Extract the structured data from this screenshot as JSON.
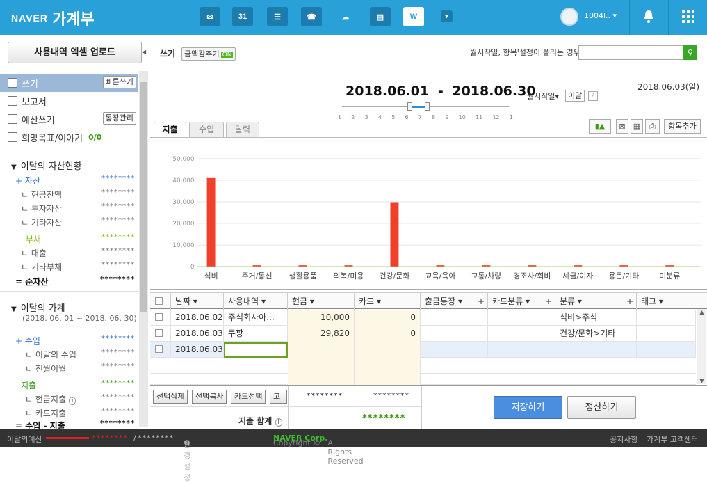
{
  "app": {
    "brand": "NAVER",
    "title": "가계부"
  },
  "topbar": {
    "icons": [
      "mail-icon",
      "calendar-icon",
      "list-icon",
      "contacts-icon",
      "cloud-icon",
      "memo-icon",
      "household-icon",
      "more-icon"
    ],
    "calendar_number": "31",
    "household_letter": "W",
    "username": "1004l..",
    "dropdown": "▾"
  },
  "sidebar": {
    "upload_button": "사용내역 엑셀 업로드",
    "menu": [
      {
        "label": "쓰기",
        "button": "빠른쓰기"
      },
      {
        "label": "보고서"
      },
      {
        "label": "예산쓰기",
        "button": "통장관리"
      },
      {
        "label": "희망목표/이야기",
        "extra": "0/0"
      }
    ],
    "assets_title": "이달의 자산현황",
    "assets": [
      {
        "label": "+ 자산",
        "value": "********"
      },
      {
        "label": "현금잔액",
        "value": "********"
      },
      {
        "label": "투자자산",
        "value": "********"
      },
      {
        "label": "기타자산",
        "value": "********"
      },
      {
        "label": "부채",
        "value": "********"
      },
      {
        "label": "대출",
        "value": "********"
      },
      {
        "label": "기타부채",
        "value": "********"
      },
      {
        "label": "= 순자산",
        "value": "********"
      }
    ],
    "ledger_title": "이달의 가계",
    "ledger_range": "(2018. 06. 01 ~ 2018. 06. 30)",
    "ledger": [
      {
        "label": "+ 수입",
        "value": "********"
      },
      {
        "label": "이달의 수입",
        "value": "********"
      },
      {
        "label": "전월이월",
        "value": "********"
      },
      {
        "label": "- 지출",
        "value": "********"
      },
      {
        "label": "현금지출",
        "value": "********"
      },
      {
        "label": "카드지출",
        "value": "********"
      },
      {
        "label": "= 수입 - 지출",
        "value": "********"
      }
    ]
  },
  "header": {
    "write_label": "쓰기",
    "hide_amount": "금액감추기",
    "on": "ON",
    "notice": "'월시작일, 항목'설정이 풀리는 경우",
    "search_placeholder": "",
    "date_start": "2018.06.01",
    "date_sep": "-",
    "date_end": "2018.06.30",
    "today": "2018.06.03(일)",
    "month_start": "월시작일▾",
    "this_month": "이달",
    "help": "?",
    "slider_ticks": [
      "1",
      "2",
      "3",
      "4",
      "5",
      "6",
      "7",
      "8",
      "9",
      "10",
      "11",
      "12",
      "1"
    ]
  },
  "tabs": [
    "지출",
    "수입",
    "달력"
  ],
  "tools": {
    "add_item": "항목추가"
  },
  "chart_data": {
    "type": "bar",
    "categories": [
      "식비",
      "주거/통신",
      "생활용품",
      "의복/미용",
      "건강/문화",
      "교육/육아",
      "교통/차량",
      "경조사/회비",
      "세금/이자",
      "용돈/기타",
      "미분류"
    ],
    "values": [
      41000,
      0,
      0,
      0,
      29820,
      0,
      0,
      0,
      0,
      0,
      0
    ],
    "ylim": [
      0,
      50000
    ],
    "yticks": [
      "50,000",
      "40,000",
      "30,000",
      "20,000",
      "10,000",
      "0"
    ],
    "grid": true,
    "bar_color": "#f0402a"
  },
  "table": {
    "headers": [
      "날짜",
      "사용내역",
      "현금",
      "카드",
      "출금통장",
      "카드분류",
      "분류",
      "태그"
    ],
    "rows": [
      {
        "date": "2018.06.02",
        "desc": "주식회사아...",
        "cash": "10,000",
        "card": "0",
        "account": "",
        "cardcat": "",
        "category": "식비>주식",
        "tag": ""
      },
      {
        "date": "2018.06.03",
        "desc": "쿠팡",
        "cash": "29,820",
        "card": "0",
        "account": "",
        "cardcat": "",
        "category": "건강/문화>기타",
        "tag": ""
      },
      {
        "date": "2018.06.03",
        "desc": "",
        "cash": "",
        "card": "",
        "account": "",
        "cardcat": "",
        "category": "",
        "tag": ""
      }
    ]
  },
  "bottom": {
    "buttons": [
      "선택삭제",
      "선택복사",
      "카드선택",
      "고정"
    ],
    "cash_total": "********",
    "card_total": "********",
    "total_label": "지출 합계",
    "grand_total": "********",
    "save": "저장하기",
    "settle": "정산하기"
  },
  "footer": {
    "budget_label": "이달의예산",
    "budget_value": "********",
    "budget_sep": "/",
    "budget_total": "********",
    "settings": "환경설정",
    "copyright_pre": "Copyright ©",
    "copyright_corp": "NAVER Corp.",
    "copyright_post": "All Rights Reserved",
    "notice": "공지사항",
    "support": "가계부 고객센터"
  }
}
